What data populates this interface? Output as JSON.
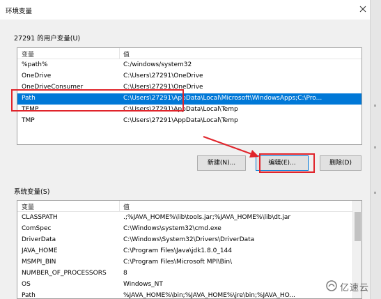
{
  "window": {
    "title": "环境变量",
    "close_icon": "close-icon"
  },
  "user_vars": {
    "group_label": "27291 的用户变量(U)",
    "columns": [
      "变量",
      "值"
    ],
    "rows": [
      {
        "name": "%path%",
        "value": "C:/windows/system32"
      },
      {
        "name": "OneDrive",
        "value": "C:\\Users\\27291\\OneDrive"
      },
      {
        "name": "OneDriveConsumer",
        "value": "C:\\Users\\27291\\OneDrive"
      },
      {
        "name": "Path",
        "value": "C:\\Users\\27291\\AppData\\Local\\Microsoft\\WindowsApps;C:\\Pro..."
      },
      {
        "name": "TEMP",
        "value": "C:\\Users\\27291\\AppData\\Local\\Temp"
      },
      {
        "name": "TMP",
        "value": "C:\\Users\\27291\\AppData\\Local\\Temp"
      }
    ],
    "selected_row": "Path",
    "buttons": {
      "new": "新建(N)...",
      "edit": "编辑(E)...",
      "delete": "删除(D)"
    }
  },
  "system_vars": {
    "group_label": "系统变量(S)",
    "columns": [
      "变量",
      "值"
    ],
    "rows": [
      {
        "name": "CLASSPATH",
        "value": ".;%JAVA_HOME%\\lib\\tools.jar;%JAVA_HOME%\\lib\\dt.jar"
      },
      {
        "name": "ComSpec",
        "value": "C:\\Windows\\system32\\cmd.exe"
      },
      {
        "name": "DriverData",
        "value": "C:\\Windows\\System32\\Drivers\\DriverData"
      },
      {
        "name": "JAVA_HOME",
        "value": "C:\\Program Files\\Java\\jdk1.8.0_144"
      },
      {
        "name": "MSMPI_BIN",
        "value": "C:\\Program Files\\Microsoft MPI\\Bin\\"
      },
      {
        "name": "NUMBER_OF_PROCESSORS",
        "value": "8"
      },
      {
        "name": "OS",
        "value": "Windows_NT"
      }
    ],
    "partial_row": {
      "name": "Path",
      "value": "%JAVA_HOME%\\bin;%JAVA_HOME%\\jre\\bin;%JAVA_HO..."
    }
  },
  "watermark": {
    "text": "亿速云",
    "logo_icon": "yisu-cloud-logo-icon"
  },
  "colors": {
    "selection": "#0078d7",
    "annotation": "#e0242b"
  }
}
